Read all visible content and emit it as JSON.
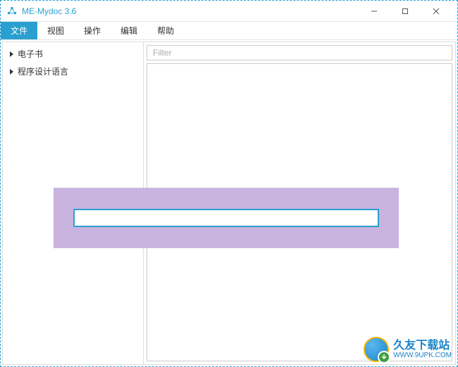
{
  "window": {
    "title": "ME-Mydoc 3.6"
  },
  "menu": {
    "items": [
      {
        "label": "文件",
        "active": true
      },
      {
        "label": "视图",
        "active": false
      },
      {
        "label": "操作",
        "active": false
      },
      {
        "label": "编辑",
        "active": false
      },
      {
        "label": "帮助",
        "active": false
      }
    ]
  },
  "sidebar": {
    "items": [
      {
        "label": "电子书"
      },
      {
        "label": "程序设计语言"
      }
    ]
  },
  "main": {
    "filter_placeholder": "Filter"
  },
  "modal": {
    "input_value": ""
  },
  "watermark": {
    "main": "久友下载站",
    "sub": "WWW.9UPK.COM"
  }
}
